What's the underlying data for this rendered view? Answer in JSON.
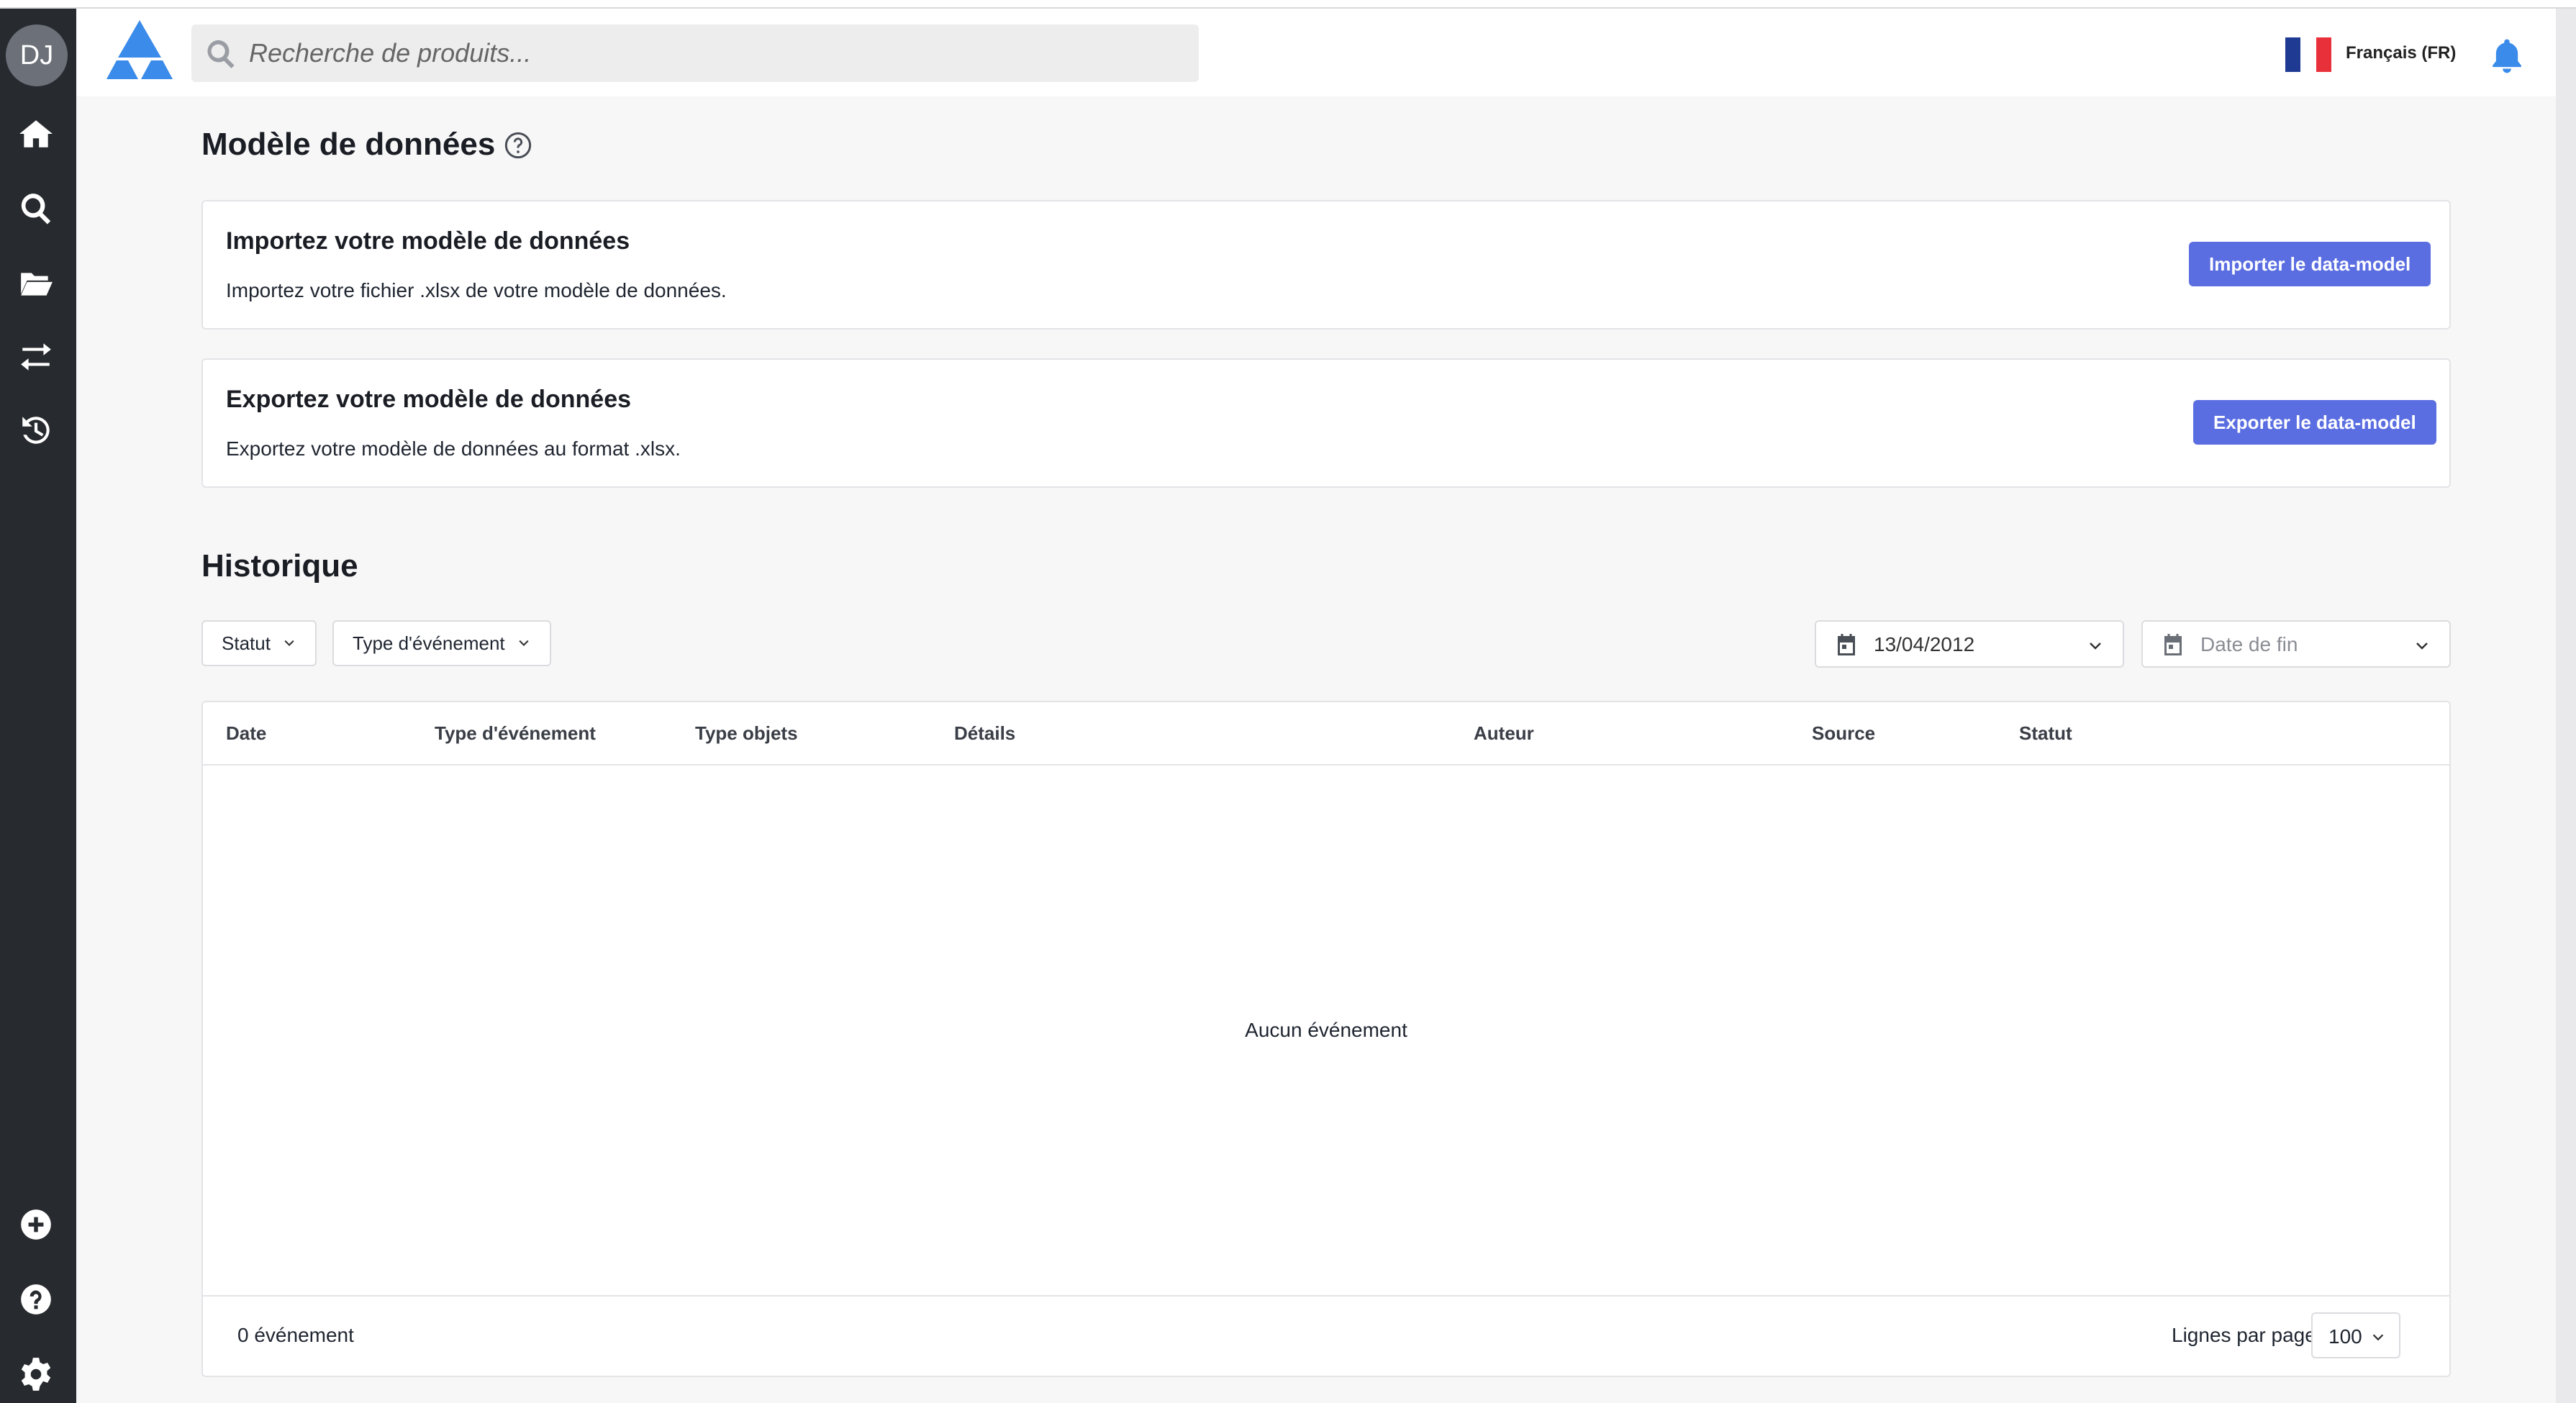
{
  "sidebar": {
    "avatar_initials": "DJ",
    "nav": [
      "home-icon",
      "search-icon",
      "folder-icon",
      "transfer-icon",
      "history-icon"
    ],
    "bottom": [
      "add-icon",
      "help-icon",
      "settings-icon"
    ]
  },
  "header": {
    "search_placeholder": "Recherche de produits...",
    "language": "Français (FR)"
  },
  "page": {
    "title": "Modèle de données"
  },
  "import_card": {
    "title": "Importez votre modèle de données",
    "description": "Importez votre fichier .xlsx de votre modèle de données.",
    "button": "Importer le data-model"
  },
  "export_card": {
    "title": "Exportez votre modèle de données",
    "description": "Exportez votre modèle de données au format .xlsx.",
    "button": "Exporter le data-model"
  },
  "history": {
    "title": "Historique",
    "filters": {
      "status": "Statut",
      "event_type": "Type d'événement"
    },
    "start_date": "13/04/2012",
    "end_date_placeholder": "Date de fin",
    "columns": [
      "Date",
      "Type d'événement",
      "Type objets",
      "Détails",
      "Auteur",
      "Source",
      "Statut"
    ],
    "empty_message": "Aucun événement",
    "count_label": "0 événement",
    "rows_per_page_label": "Lignes par page",
    "rows_per_page": "100"
  },
  "colors": {
    "sidebar": "#272a2e",
    "primary": "#5b6ee1",
    "logo": "#3b8bea",
    "bell": "#3b8bea"
  }
}
